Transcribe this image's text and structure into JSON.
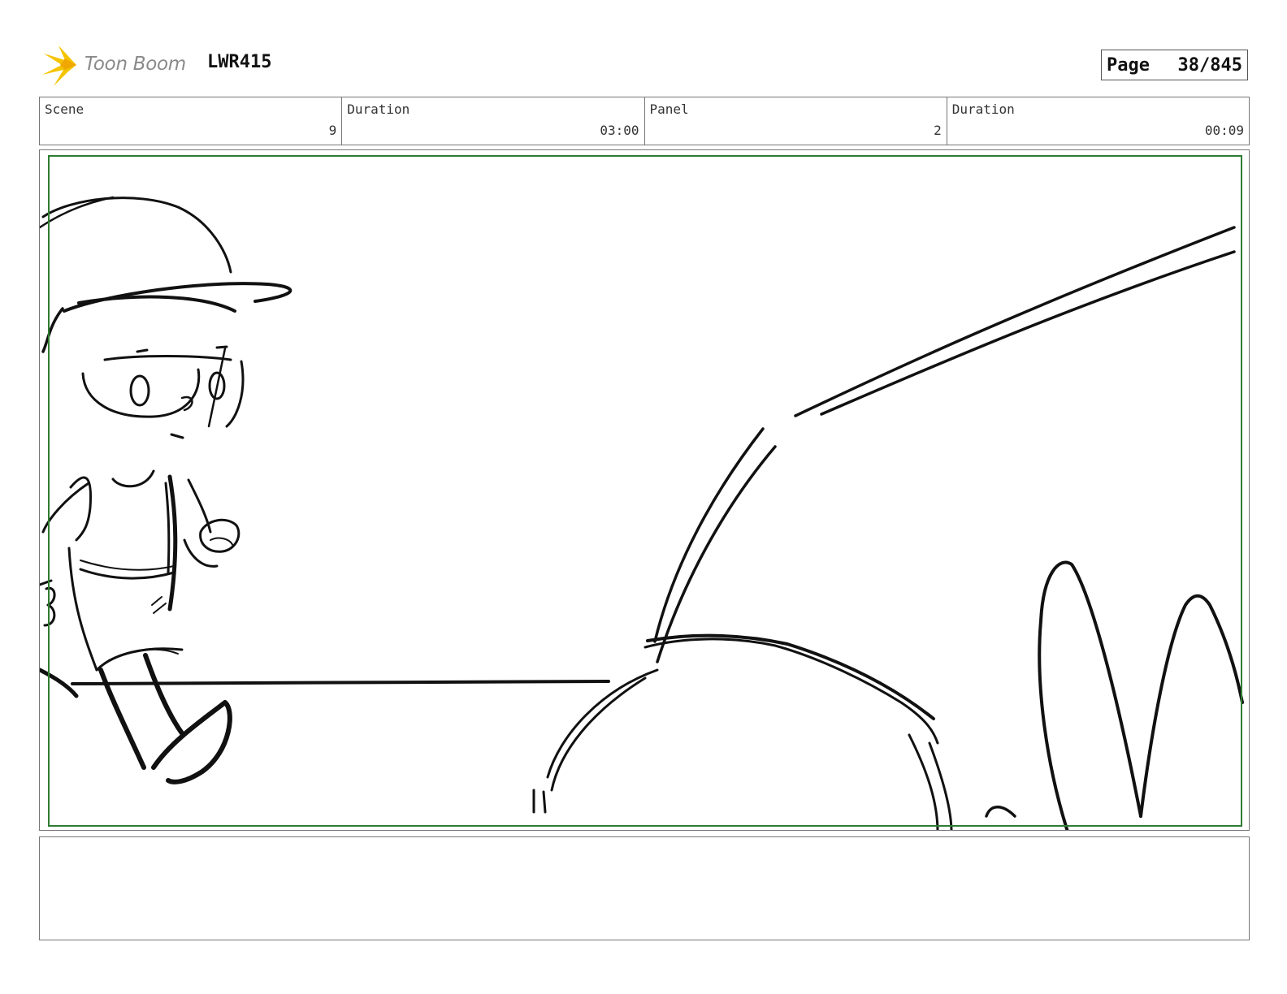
{
  "header": {
    "logo_text": "Toon Boom",
    "project_code": "LWR415",
    "page_label": "Page",
    "page_number": "38/845"
  },
  "info": {
    "scene_label": "Scene",
    "scene_value": "9",
    "scene_duration_label": "Duration",
    "scene_duration_value": "03:00",
    "panel_label": "Panel",
    "panel_value": "2",
    "panel_duration_label": "Duration",
    "panel_duration_value": "00:09"
  },
  "colors": {
    "safe_frame": "#2e7d32",
    "logo_star": "#f5c400",
    "sketch_line": "#111111"
  },
  "notes": {
    "text": ""
  }
}
